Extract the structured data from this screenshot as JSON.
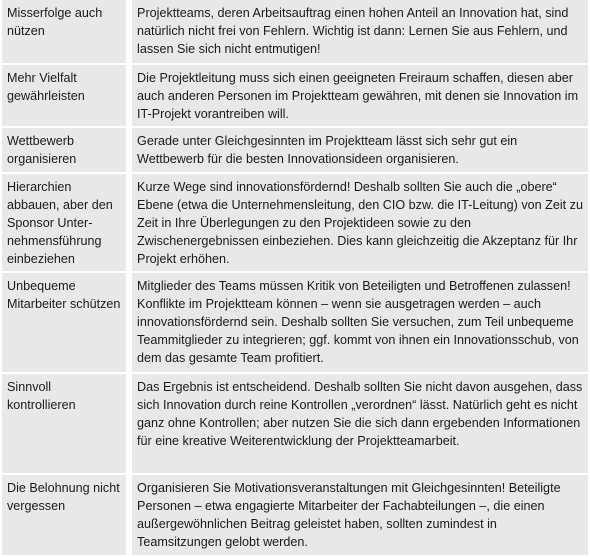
{
  "rows": [
    {
      "label": "Misserfolge auch nützen",
      "text": "Projektteams, deren Arbeitsauftrag einen hohen Anteil an Innovation hat, sind natürlich nicht frei von Fehlern. Wichtig ist dann: Lernen Sie aus Fehlern, und lassen Sie sich nicht entmutigen!"
    },
    {
      "label": "Mehr Vielfalt gewährleisten",
      "text": "Die Projektleitung muss sich einen geeigneten Freiraum schaffen, diesen aber auch anderen Personen im Projektteam gewähren, mit denen sie Innovation im IT-Projekt vorantreiben will."
    },
    {
      "label": "Wettbewerb organisieren",
      "text": "Gerade unter Gleichgesinnten im Projektteam lässt sich sehr gut ein Wettbewerb für die besten Innovationsideen organisieren."
    },
    {
      "label": "Hierarchien abbauen, aber den Sponsor Unter­nehmensführung einbeziehen",
      "text": "Kurze Wege sind innovationsfördernd! Deshalb sollten Sie auch die „obere“ Ebene (etwa die Unternehmensleitung, den CIO bzw. die IT-Leitung) von Zeit zu Zeit in Ihre Überlegungen zu den Projektideen sowie zu den Zwischenergebnissen einbeziehen. Dies kann gleichzeitig die Akzeptanz für Ihr Projekt erhöhen."
    },
    {
      "label": "Unbequeme Mitarbeiter schützen",
      "text": "Mitglieder des Teams müssen Kritik von Beteiligten und Betroffenen zulas­sen! Konflikte im Projektteam können – wenn sie ausgetragen werden – auch innovationsfördernd sein. Deshalb sollten Sie versuchen, zum Teil unbequeme Teammitglieder zu integrieren; ggf. kommt von ihnen ein Innovationsschub, von dem das gesamte Team profitiert."
    },
    {
      "label": "Sinnvoll kontrollieren",
      "text": "Das Ergebnis ist entscheidend. Deshalb sollten Sie nicht davon ausgehen, dass sich Innovation durch reine Kontrollen „verordnen“ lässt. Natürlich geht es nicht ganz ohne Kontrollen; aber nutzen Sie die sich dann erge­benden Informationen für eine kreative Weiterentwicklung der Projekt­teamarbeit."
    },
    {
      "label": "Die Belohnung nicht vergessen",
      "text": "Organisieren Sie Motivationsveranstaltungen mit Gleichgesinnten! Betei­ligte Personen – etwa engagierte Mitarbeiter der Fachabteilungen –, die einen außergewöhnlichen Beitrag geleistet haben, sollten zumindest in Teamsitzungen gelobt werden."
    }
  ],
  "colors": {
    "cell_background": "#e8e8e8",
    "text": "#1a1a1a"
  }
}
